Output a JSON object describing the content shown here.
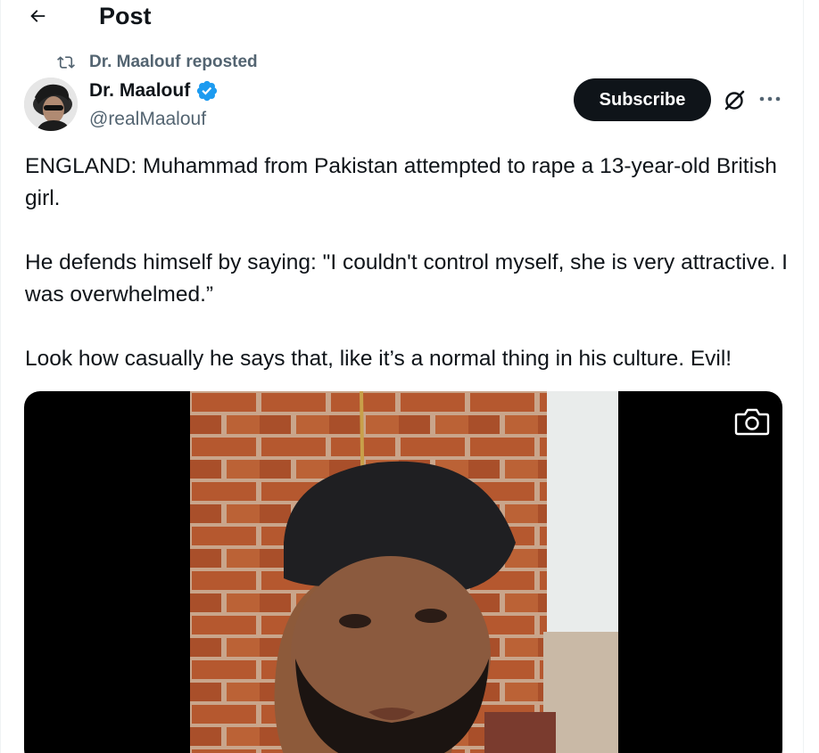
{
  "header": {
    "title": "Post",
    "back_icon": "arrow-left-icon"
  },
  "repost": {
    "icon": "repost-icon",
    "user": "Dr. Maalouf",
    "label": "reposted"
  },
  "author": {
    "display_name": "Dr. Maalouf",
    "handle": "@realMaalouf",
    "verified_icon": "verified-badge-icon",
    "verified_color": "#1d9bf0"
  },
  "actions": {
    "subscribe_label": "Subscribe",
    "grok_icon": "grok-icon",
    "more_icon": "more-icon"
  },
  "tweet": {
    "paragraphs": [
      "ENGLAND: Muhammad from Pakistan attempted to rape a 13-year-old British girl.",
      "He defends himself by saying: \"I couldn't control myself, she is very attractive. I was overwhelmed.”",
      "Look how casually he says that, like it’s a normal thing in his culture. Evil!"
    ]
  },
  "media": {
    "type": "video",
    "camera_icon": "camera-icon"
  },
  "colors": {
    "text_primary": "#0f1419",
    "text_secondary": "#536471",
    "accent": "#1d9bf0",
    "button_dark": "#0f1419"
  }
}
